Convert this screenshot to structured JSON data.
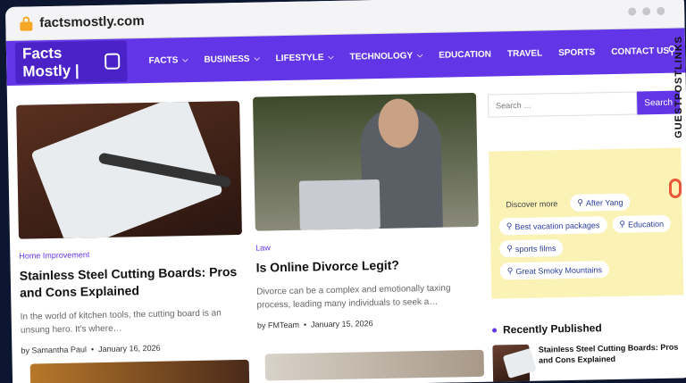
{
  "browser": {
    "url": "factsmostly.com"
  },
  "nav": {
    "logo": "Facts Mostly |",
    "items": [
      {
        "label": "FACTS",
        "dropdown": true
      },
      {
        "label": "BUSINESS",
        "dropdown": true
      },
      {
        "label": "LIFESTYLE",
        "dropdown": true
      },
      {
        "label": "TECHNOLOGY",
        "dropdown": true
      },
      {
        "label": "EDUCATION",
        "dropdown": false
      },
      {
        "label": "TRAVEL",
        "dropdown": false
      },
      {
        "label": "SPORTS",
        "dropdown": false
      },
      {
        "label": "CONTACT US",
        "dropdown": false
      }
    ]
  },
  "posts": [
    {
      "category": "Home Improvement",
      "title": "Stainless Steel Cutting Boards: Pros and Cons Explained",
      "excerpt": "In the world of kitchen tools, the cutting board is an unsung hero. It's where…",
      "author": "by Samantha Paul",
      "date": "January 16, 2026"
    },
    {
      "category": "Law",
      "title": "Is Online Divorce Legit?",
      "excerpt": "Divorce can be a complex and emotionally taxing process, leading many individuals to seek a…",
      "author": "by FMTeam",
      "date": "January 15, 2026"
    }
  ],
  "sidebar": {
    "search_placeholder": "Search …",
    "search_button": "Search",
    "discover": "Discover more",
    "tags": [
      "After Yang",
      "Best vacation packages",
      "Education",
      "sports films",
      "Great Smoky Mountains"
    ],
    "recent_heading": "Recently Published",
    "recent_items": [
      {
        "title": "Stainless Steel Cutting Boards: Pros and Cons Explained"
      }
    ]
  },
  "watermark": "GUESTPOSTLINKS",
  "colors": {
    "accent": "#6236e6",
    "ad_bg": "#fbf2b6",
    "lock": "#f5a623"
  }
}
